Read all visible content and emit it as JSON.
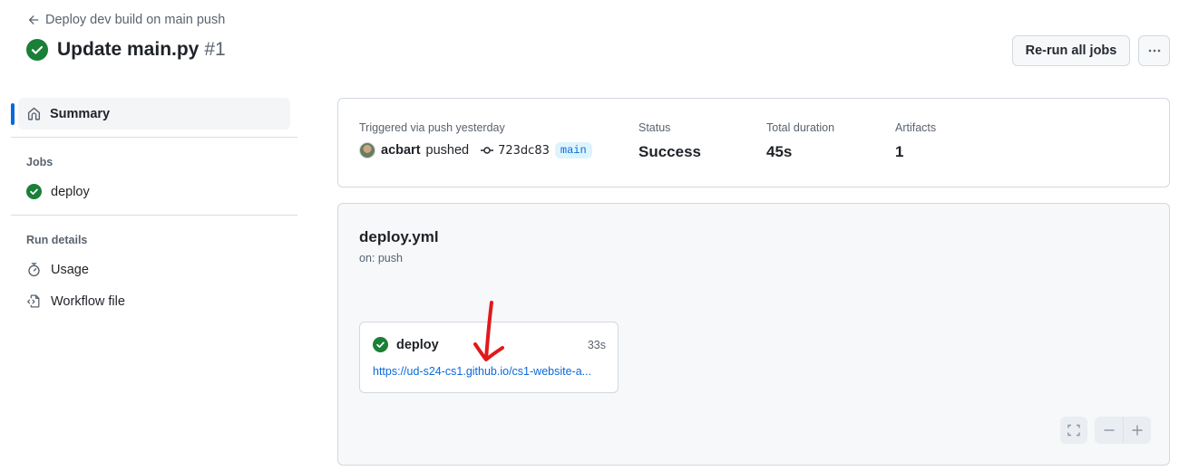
{
  "header": {
    "back_label": "Deploy dev build on main push",
    "title": "Update main.py",
    "run_number": "#1",
    "status_icon": "check-circle-icon",
    "rerun_label": "Re-run all jobs",
    "more_icon": "kebab-horizontal-icon"
  },
  "sidebar": {
    "summary_label": "Summary",
    "jobs_section": "Jobs",
    "jobs": [
      {
        "label": "deploy",
        "status": "success"
      }
    ],
    "run_details_section": "Run details",
    "run_details": [
      {
        "label": "Usage",
        "icon": "stopwatch-icon"
      },
      {
        "label": "Workflow file",
        "icon": "file-code-icon"
      }
    ]
  },
  "summary": {
    "trigger_label": "Triggered via push yesterday",
    "user": "acbart",
    "action": "pushed",
    "commit": "723dc83",
    "branch": "main",
    "status_label": "Status",
    "status_value": "Success",
    "duration_label": "Total duration",
    "duration_value": "45s",
    "artifacts_label": "Artifacts",
    "artifacts_value": "1"
  },
  "graph": {
    "workflow_file": "deploy.yml",
    "trigger": "on: push",
    "job": {
      "name": "deploy",
      "duration": "33s",
      "url": "https://ud-s24-cs1.github.io/cs1-website-a..."
    }
  },
  "colors": {
    "success": "#1a7f37",
    "accent": "#0969da",
    "annotation": "#e0191c"
  }
}
